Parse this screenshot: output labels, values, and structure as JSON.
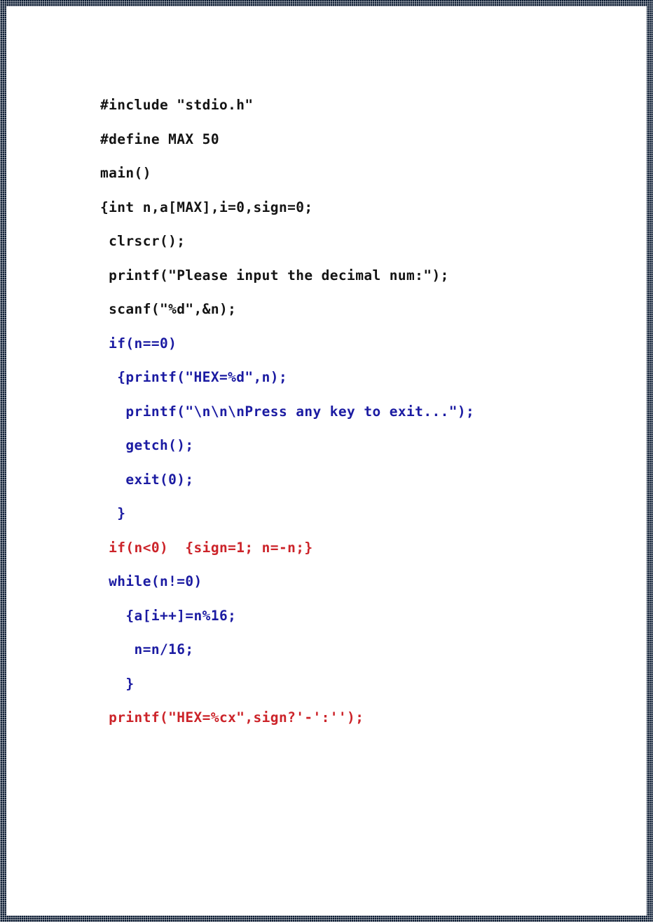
{
  "document": {
    "kind": "scanned-code-listing",
    "language": "C",
    "page_background": "#ffffff",
    "border_color": "#0c1c33",
    "colors": {
      "black": "#141414",
      "blue": "#1b1ba2",
      "red": "#cc2329"
    },
    "code_lines": [
      {
        "text": "#include \"stdio.h\"",
        "color": "black"
      },
      {
        "text": "#define MAX 50",
        "color": "black"
      },
      {
        "text": "main()",
        "color": "black"
      },
      {
        "text": "{int n,a[MAX],i=0,sign=0;",
        "color": "black"
      },
      {
        "text": " clrscr();",
        "color": "black"
      },
      {
        "text": " printf(\"Please input the decimal num:\");",
        "color": "black"
      },
      {
        "text": " scanf(\"%d\",&n);",
        "color": "black"
      },
      {
        "text": " if(n==0)",
        "color": "blue"
      },
      {
        "text": "  {printf(\"HEX=%d\",n);",
        "color": "blue"
      },
      {
        "text": "   printf(\"\\n\\n\\nPress any key to exit...\");",
        "color": "blue"
      },
      {
        "text": "   getch();",
        "color": "blue"
      },
      {
        "text": "   exit(0);",
        "color": "blue"
      },
      {
        "text": "  }",
        "color": "blue"
      },
      {
        "text": " if(n<0)  {sign=1; n=-n;}",
        "color": "red"
      },
      {
        "text": " while(n!=0)",
        "color": "blue"
      },
      {
        "text": "   {a[i++]=n%16;",
        "color": "blue"
      },
      {
        "text": "    n=n/16;",
        "color": "blue"
      },
      {
        "text": "   }",
        "color": "blue"
      },
      {
        "text": " printf(\"HEX=%cx\",sign?'-':'');",
        "color": "red"
      }
    ]
  }
}
